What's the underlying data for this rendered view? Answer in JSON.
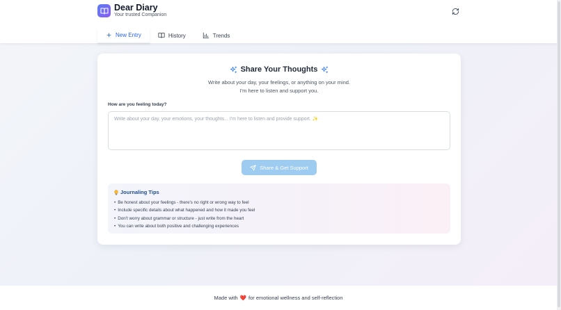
{
  "app": {
    "title": "Dear Diary",
    "subtitle": "Your trusted Companion",
    "logo_icon": "book-icon",
    "accent_color": "#2563eb"
  },
  "header": {
    "refresh_icon": "refresh-icon"
  },
  "tabs": [
    {
      "label": "New Entry",
      "icon": "plus-icon",
      "active": true
    },
    {
      "label": "History",
      "icon": "book-open-icon",
      "active": false
    },
    {
      "label": "Trends",
      "icon": "bar-chart-icon",
      "active": false
    }
  ],
  "card": {
    "title": "Share Your Thoughts",
    "title_icon": "sparkles-icon",
    "description": "Write about your day, your feelings, or anything on your mind. I'm here to listen and support you.",
    "field_label": "How are you feeling today?",
    "input_value": "",
    "input_placeholder": "Write about your day, your emotions, your thoughts... I'm here to listen and provide support. ✨",
    "submit_label": "Share & Get Support",
    "submit_icon": "send-icon",
    "submit_color": "#9ecbf0"
  },
  "tips": {
    "icon": "lightbulb-icon",
    "title": "Journaling Tips",
    "items": [
      "Be honest about your feelings - there's no right or wrong way to feel",
      "Include specific details about what happened and how it made you feel",
      "Don't worry about grammar or structure - just write from the heart",
      "You can write about both positive and challenging experiences"
    ]
  },
  "footer": {
    "text_before": "Made with",
    "heart": "❤️",
    "text_after": "for emotional wellness and self-reflection"
  }
}
